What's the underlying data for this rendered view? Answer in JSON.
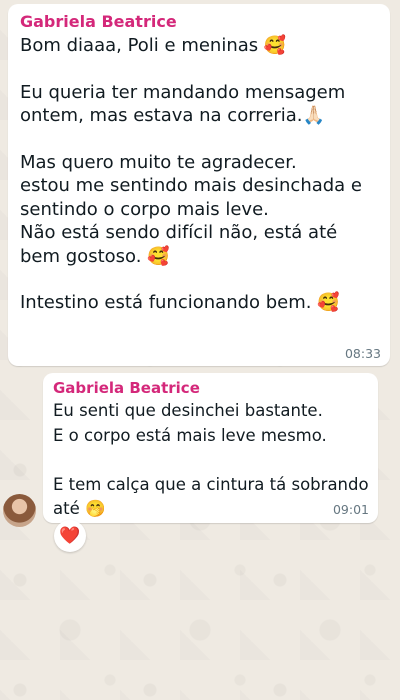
{
  "messages": [
    {
      "sender": "Gabriela Beatrice",
      "text": "Bom diaaa, Poli e meninas 🥰\n\nEu queria ter mandando mensagem ontem, mas estava na correria.🙏🏻\n\nMas quero muito te agradecer.\nestou me sentindo mais desinchada e sentindo o corpo mais leve.\nNão está sendo difícil não, está até bem gostoso. 🥰\n\nIntestino está funcionando bem. 🥰",
      "time": "08:33"
    },
    {
      "sender": "Gabriela Beatrice",
      "text": "Eu senti que desinchei bastante.\nE o corpo está mais leve mesmo.\n\nE tem calça que a cintura tá sobrando até 🤭",
      "time": "09:01",
      "reaction": "❤️"
    }
  ],
  "colors": {
    "sender_name": "#d4287a",
    "bubble": "#ffffff",
    "background": "#efeae2",
    "time": "#667781"
  }
}
